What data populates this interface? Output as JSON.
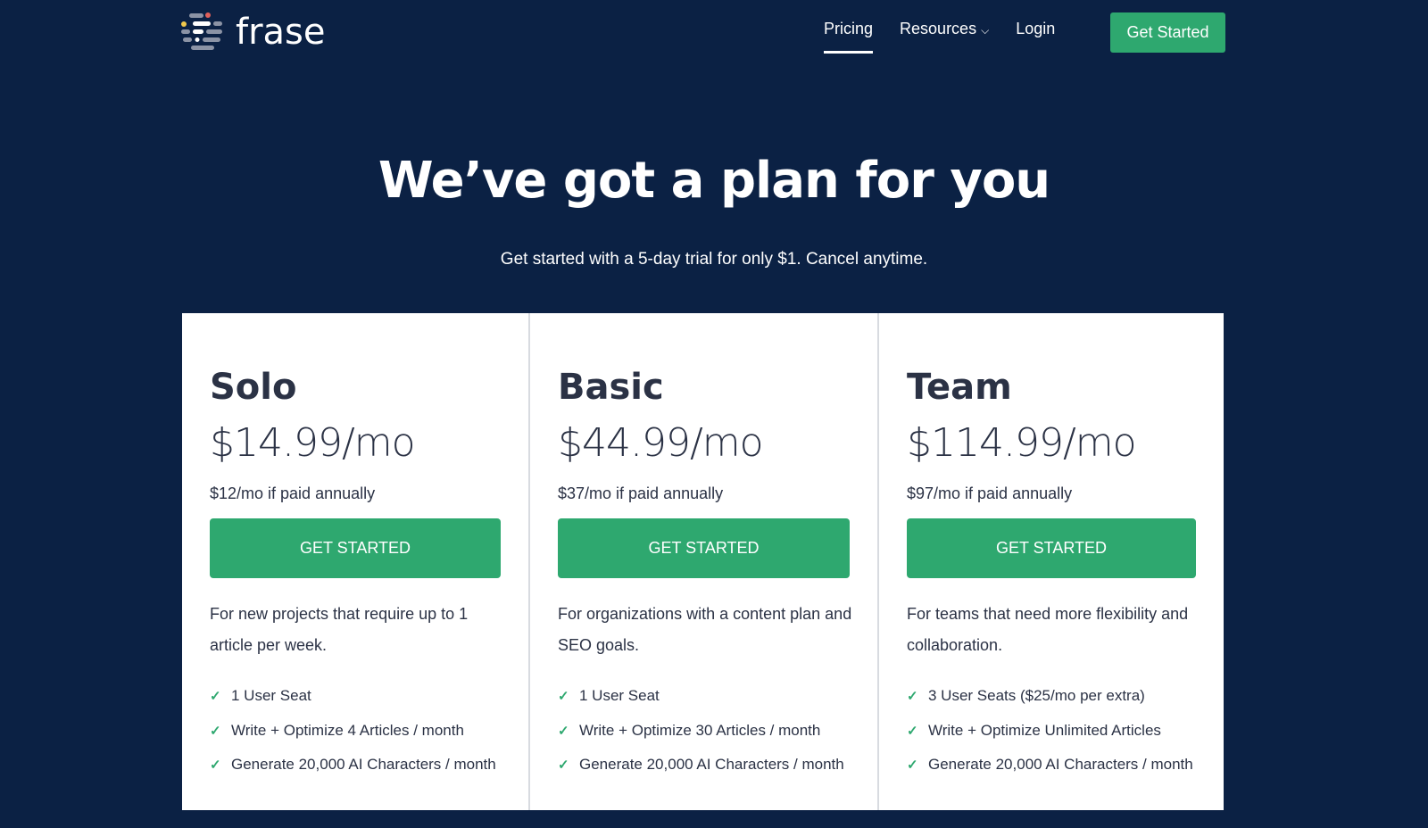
{
  "nav": {
    "logo": "frase",
    "links": [
      {
        "label": "Pricing",
        "active": true
      },
      {
        "label": "Resources",
        "has_dropdown": true
      },
      {
        "label": "Login"
      }
    ],
    "cta": "Get Started"
  },
  "hero": {
    "title": "We’ve got a plan for you",
    "subtitle": "Get started with a 5-day trial for only $1. Cancel anytime."
  },
  "colors": {
    "background": "#0b2144",
    "accent": "#2ea86f"
  },
  "plans": [
    {
      "name": "Solo",
      "price": "$14.99/mo",
      "annual": "$12/mo if paid annually",
      "button": "GET STARTED",
      "description": "For new projects that require up to 1 article per week.",
      "features": [
        "1 User Seat",
        "Write + Optimize 4 Articles / month",
        "Generate 20,000 AI Characters / month"
      ]
    },
    {
      "name": "Basic",
      "price": "$44.99/mo",
      "annual": "$37/mo if paid annually",
      "button": "GET STARTED",
      "description": "For organizations with a content plan and SEO goals.",
      "features": [
        "1 User Seat",
        "Write + Optimize 30 Articles / month",
        "Generate 20,000 AI Characters / month"
      ]
    },
    {
      "name": "Team",
      "price": "$114.99/mo",
      "annual": "$97/mo if paid annually",
      "button": "GET STARTED",
      "description": "For teams that need more flexibility and collaboration.",
      "features": [
        "3 User Seats ($25/mo per extra)",
        "Write + Optimize Unlimited Articles",
        "Generate 20,000 AI Characters / month"
      ]
    }
  ]
}
